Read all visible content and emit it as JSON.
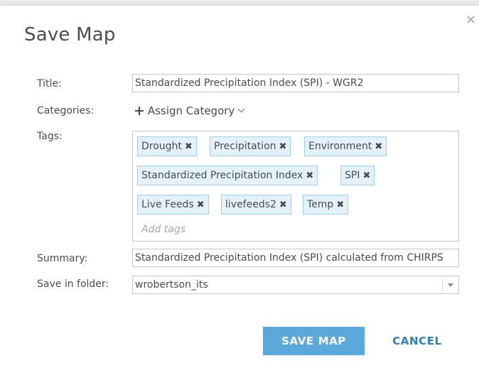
{
  "dialog": {
    "title": "Save Map",
    "close_glyph": "×"
  },
  "form": {
    "title_label": "Title:",
    "title_value": "Standardized Precipitation Index (SPI) - WGR2",
    "categories_label": "Categories:",
    "assign_category": "Assign Category",
    "tags_label": "Tags:",
    "tags": [
      "Drought",
      "Precipitation",
      "Environment",
      "Standardized Precipitation Index",
      "SPI",
      "Live Feeds",
      "livefeeds2",
      "Temp"
    ],
    "tag_remove_glyph": "✖",
    "add_tags_placeholder": "Add tags",
    "summary_label": "Summary:",
    "summary_value": "Standardized Precipitation Index (SPI) calculated from CHIRPS",
    "folder_label": "Save in folder:",
    "folder_value": "wrobertson_its"
  },
  "buttons": {
    "save": "SAVE MAP",
    "cancel": "CANCEL"
  },
  "colors": {
    "save_button": "#5ba8da",
    "cancel_text": "#2f7fbd",
    "tag_background": "#e2f1fb",
    "tag_border": "#9fd2ef"
  },
  "icons": {
    "close": "close-icon",
    "add": "plus-icon",
    "dropdown": "chevron-down-icon",
    "tag_remove": "remove-tag-icon",
    "select_caret": "caret-down-icon"
  }
}
